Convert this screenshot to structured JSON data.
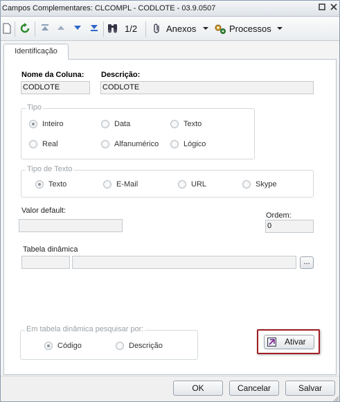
{
  "window": {
    "title": "Campos Complementares: CLCOMPL - CODLOTE - 03.9.0507"
  },
  "toolbar": {
    "page_indicator": "1/2",
    "anexos_label": "Anexos",
    "processos_label": "Processos"
  },
  "tabs": [
    {
      "label": "Identificação"
    }
  ],
  "form": {
    "nome_coluna_label": "Nome da Coluna:",
    "nome_coluna_value": "CODLOTE",
    "descricao_label": "Descrição:",
    "descricao_value": "CODLOTE",
    "tipo": {
      "label": "Tipo",
      "options": [
        "Inteiro",
        "Data",
        "Texto",
        "Real",
        "Alfanumérico",
        "Lógico"
      ],
      "selected": "Inteiro"
    },
    "tipo_texto": {
      "label": "Tipo de Texto",
      "options": [
        "Texto",
        "E-Mail",
        "URL",
        "Skype"
      ],
      "selected": "Texto"
    },
    "valor_default_label": "Valor default:",
    "valor_default_value": "",
    "ordem_label": "Ordem:",
    "ordem_value": "0",
    "tabela_dinamica_label": "Tabela dinâmica",
    "browse_label": "...",
    "pesquisar_por": {
      "label": "Em tabela dinâmica pesquisar por:",
      "options": [
        "Código",
        "Descrição"
      ],
      "selected": "Código"
    },
    "ativar_label": "Ativar"
  },
  "footer": {
    "ok_label": "OK",
    "cancel_label": "Cancelar",
    "save_label": "Salvar"
  },
  "colors": {
    "highlight_border": "#a01c24",
    "window_border": "#8a9bb0"
  }
}
